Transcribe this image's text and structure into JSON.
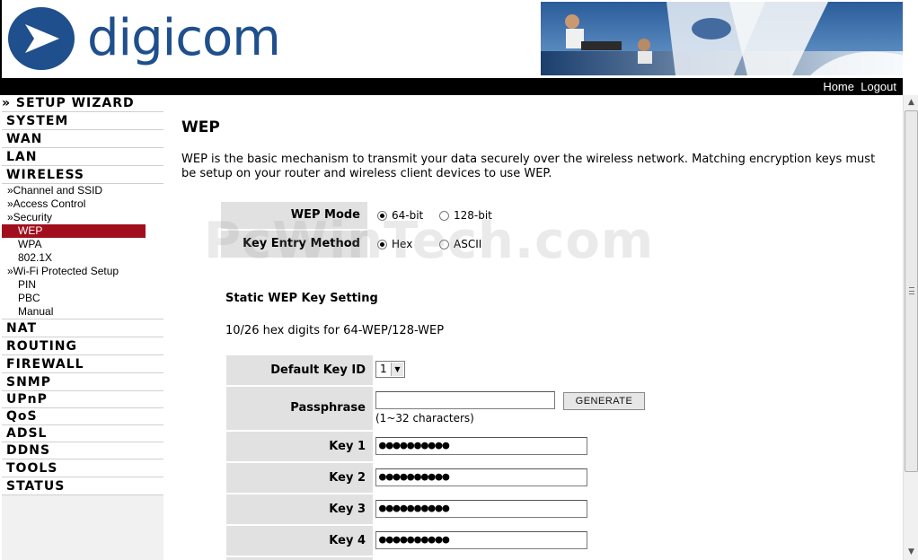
{
  "header": {
    "logo_text": "digicom",
    "nav": {
      "home": "Home",
      "logout": "Logout"
    }
  },
  "sidebar": {
    "setup_wizard": "» SETUP WIZARD",
    "system": "SYSTEM",
    "wan": "WAN",
    "lan": "LAN",
    "wireless": "WIRELESS",
    "wireless_items": {
      "channel": "»Channel and SSID",
      "access": "»Access Control",
      "security": "»Security",
      "wep": "WEP",
      "wpa": "WPA",
      "x8021": "802.1X",
      "wps": "»Wi-Fi Protected Setup",
      "pin": "PIN",
      "pbc": "PBC",
      "manual": "Manual"
    },
    "nat": "NAT",
    "routing": "ROUTING",
    "firewall": "FIREWALL",
    "snmp": "SNMP",
    "upnp": "UPnP",
    "qos": "QoS",
    "adsl": "ADSL",
    "ddns": "DDNS",
    "tools": "TOOLS",
    "status": "STATUS"
  },
  "main": {
    "title": "WEP",
    "intro": "WEP is the basic mechanism to transmit your data securely over the wireless network. Matching encryption keys must be setup on your router and wireless client devices to use WEP.",
    "wep_mode": {
      "label": "WEP Mode",
      "option_64": "64-bit",
      "option_128": "128-bit",
      "selected": "64-bit"
    },
    "key_entry": {
      "label": "Key Entry Method",
      "option_hex": "Hex",
      "option_ascii": "ASCII",
      "selected": "Hex"
    },
    "static_heading": "Static WEP Key Setting",
    "hex_note": "10/26 hex digits for 64-WEP/128-WEP",
    "default_key": {
      "label": "Default Key ID",
      "value": "1"
    },
    "passphrase": {
      "label": "Passphrase",
      "value": "",
      "hint": "(1~32 characters)",
      "button": "GENERATE"
    },
    "keys": [
      {
        "label": "Key 1",
        "value": "●●●●●●●●●●"
      },
      {
        "label": "Key 2",
        "value": "●●●●●●●●●●"
      },
      {
        "label": "Key 3",
        "value": "●●●●●●●●●●"
      },
      {
        "label": "Key 4",
        "value": "●●●●●●●●●●"
      }
    ],
    "watermark": "PcWinTech.com"
  },
  "colors": {
    "brand_blue": "#1f4f8c",
    "active_menu": "#a10f1e",
    "label_bg": "#e1e1e1",
    "topbar": "#000000"
  }
}
